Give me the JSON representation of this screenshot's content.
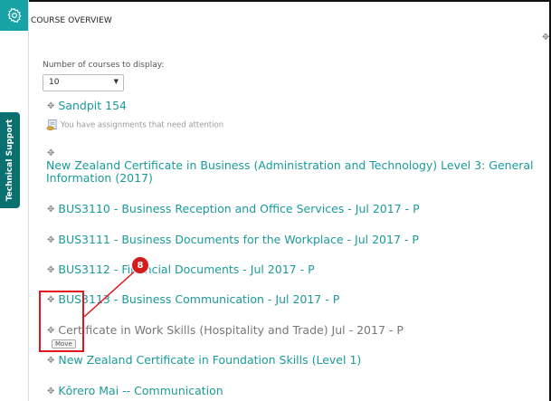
{
  "block": {
    "title": "COURSE OVERVIEW"
  },
  "side_tab": {
    "label": "Technical Support"
  },
  "settings": {
    "label": "Number of courses to display:",
    "selected": "10"
  },
  "alert": {
    "text": "You have assignments that need attention"
  },
  "courses": [
    {
      "name": "Sandpit 154"
    },
    {
      "name": "New Zealand Certificate in Business (Administration and Technology) Level 3: General Information (2017)"
    },
    {
      "name": "BUS3110 - Business Reception and Office Services - Jul 2017 - P"
    },
    {
      "name": "BUS3111 - Business Documents for the Workplace - Jul 2017 - P"
    },
    {
      "name": "BUS3112 - Financial Documents - Jul 2017 - P"
    },
    {
      "name": "BUS3113 - Business Communication - Jul 2017 - P"
    },
    {
      "name": "Certificate in Work Skills (Hospitality and Trade) Jul - 2017 - P"
    },
    {
      "name": "New Zealand Certificate in Foundation Skills (Level 1)"
    },
    {
      "name": "Kōrero Mai -- Communication"
    }
  ],
  "annotation": {
    "badge": "8",
    "tooltip": "Move"
  },
  "colors": {
    "accent": "#17a2a6",
    "link": "#1b9a9a",
    "highlight": "#e0161c",
    "tab": "#0a6f6f"
  },
  "icons": {
    "move": "move-icon",
    "settings": "gear-icon",
    "assignment": "assignment-icon"
  }
}
